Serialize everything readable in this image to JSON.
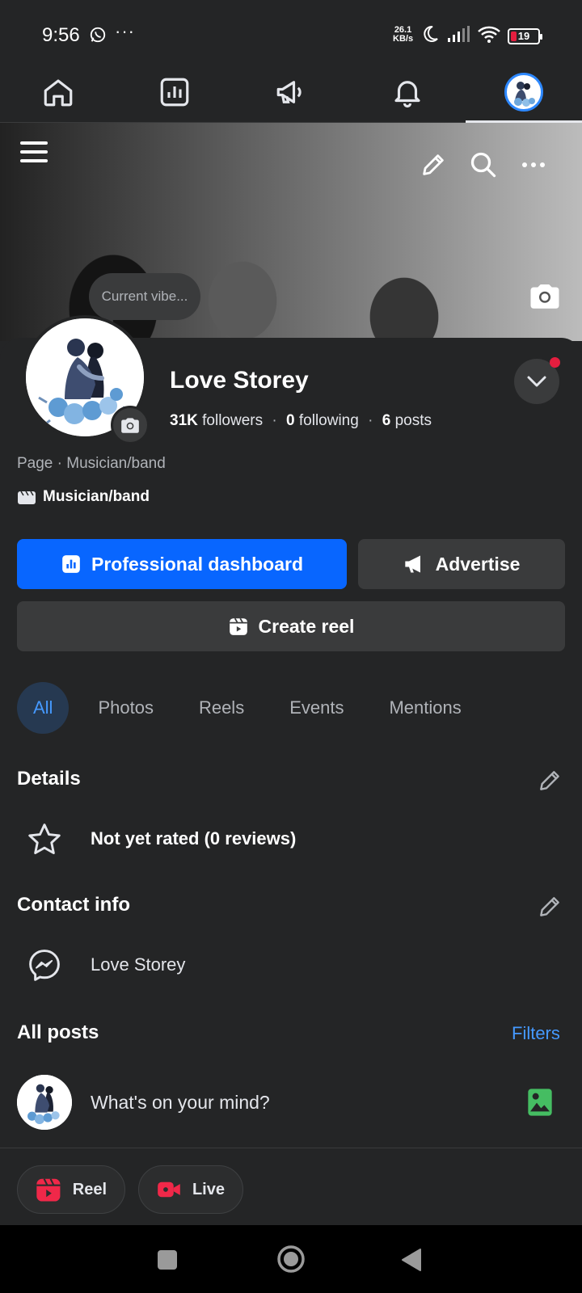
{
  "status_bar": {
    "time": "9:56",
    "dots": "···",
    "net_speed_value": "26.1",
    "net_speed_unit": "KB/s",
    "battery": "19",
    "battery_level": 0.19
  },
  "top_nav": {
    "items": [
      "home-icon",
      "dashboard-icon",
      "megaphone-icon",
      "bell-icon",
      "profile-avatar"
    ],
    "active_index": 4
  },
  "profile": {
    "bubble_text": "Current vibe...",
    "name": "Love Storey",
    "followers_count": "31K",
    "followers_label": "followers",
    "following_count": "0",
    "following_label": "following",
    "posts_count": "6",
    "posts_label": "posts",
    "separator": "·",
    "category_line": "Page · Musician/band",
    "category_bold": "Musician/band"
  },
  "actions": {
    "dashboard": "Professional dashboard",
    "advertise": "Advertise",
    "create_reel": "Create reel"
  },
  "tabs": [
    "All",
    "Photos",
    "Reels",
    "Events",
    "Mentions"
  ],
  "details": {
    "title": "Details",
    "rating": "Not yet rated (0 reviews)"
  },
  "contact": {
    "title": "Contact info",
    "messenger": "Love Storey"
  },
  "posts": {
    "title": "All posts",
    "filters": "Filters",
    "composer_placeholder": "What's on your mind?"
  },
  "composer_actions": {
    "reel": "Reel",
    "live": "Live"
  },
  "colors": {
    "background": "#242526",
    "primary": "#0866ff",
    "link": "#4599ff",
    "notification": "#e41e3f",
    "photo_green": "#45bd62"
  }
}
